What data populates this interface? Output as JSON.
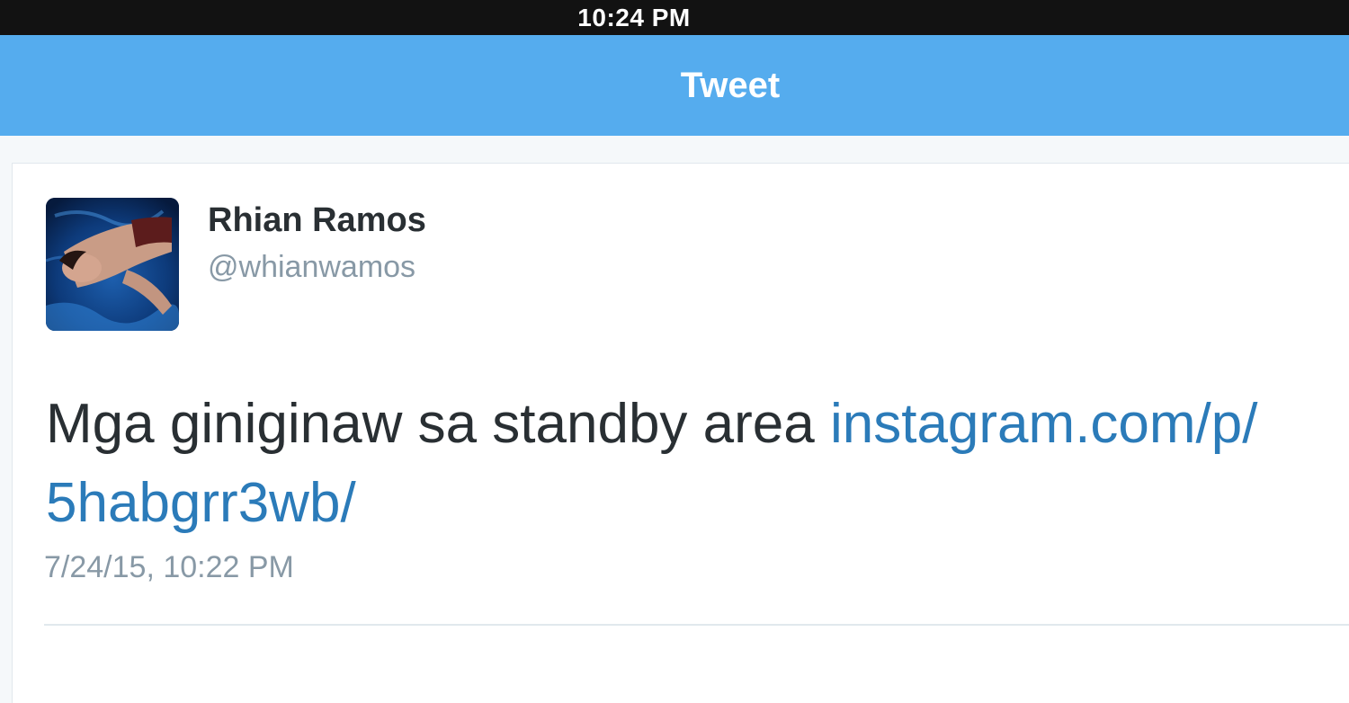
{
  "status_bar": {
    "time": "10:24 PM"
  },
  "nav": {
    "title": "Tweet"
  },
  "tweet": {
    "author": {
      "name": "Rhian Ramos",
      "handle": "@whianwamos",
      "avatar_icon": "user-avatar-photo"
    },
    "text": "Mga giniginaw sa standby area ",
    "link_line1": "instagram.com/p/",
    "link_line2": "5habgrr3wb/",
    "timestamp": "7/24/15, 10:22 PM"
  },
  "colors": {
    "nav_blue": "#55acee",
    "link_blue": "#2b7bb9",
    "muted_gray": "#8899a6",
    "text_dark": "#292f33",
    "status_bar": "#121212"
  }
}
